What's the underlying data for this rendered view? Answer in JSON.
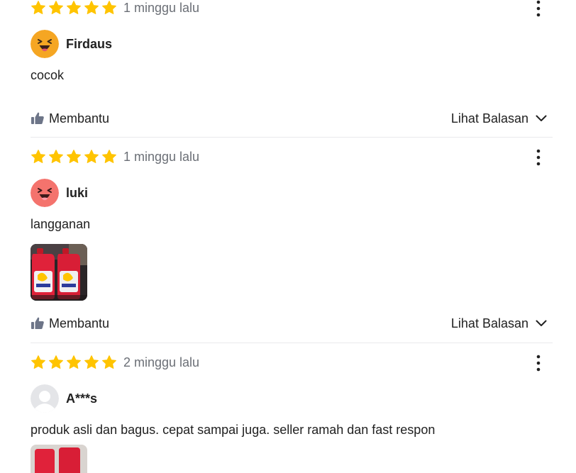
{
  "colors": {
    "star": "#ffc400",
    "muted_text": "#6b6f76",
    "text": "#212121",
    "divider": "#e9e9ec"
  },
  "actions": {
    "helpful_label": "Membantu",
    "replies_label": "Lihat Balasan"
  },
  "reviews": [
    {
      "rating": 5,
      "time": "1 minggu lalu",
      "username": "Firdaus",
      "avatar_icon": "laughing-emoji-orange-icon",
      "comment": "cocok",
      "has_image": false
    },
    {
      "rating": 5,
      "time": "1 minggu lalu",
      "username": "luki",
      "avatar_icon": "laughing-emoji-red-icon",
      "comment": "langganan",
      "has_image": true
    },
    {
      "rating": 5,
      "time": "2 minggu lalu",
      "username": "A***s",
      "avatar_icon": "default-user-icon",
      "comment": "produk asli dan bagus. cepat sampai juga. seller ramah dan fast respon",
      "has_image": true
    }
  ]
}
